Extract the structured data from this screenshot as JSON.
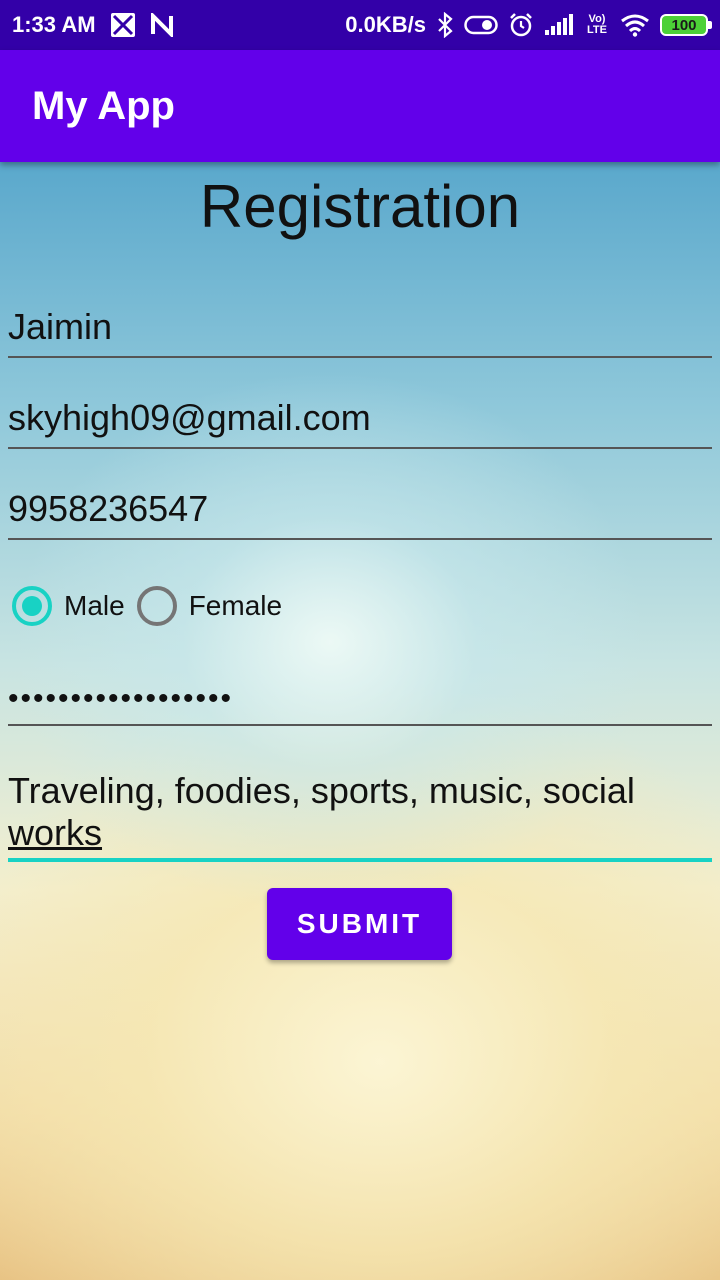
{
  "status_bar": {
    "time": "1:33 AM",
    "net_speed": "0.0KB/s",
    "battery": "100",
    "volte": "Vo) LTE"
  },
  "app_bar": {
    "title": "My App"
  },
  "form": {
    "title": "Registration",
    "name": "Jaimin",
    "email": "skyhigh09@gmail.com",
    "phone": "9958236547",
    "gender_options": [
      "Male",
      "Female"
    ],
    "gender_selected": "Male",
    "password_masked": "••••••••••••••••••",
    "interests_line1": "Traveling, foodies, sports, music, social",
    "interests_line2": "works",
    "submit_label": "SUBMIT"
  },
  "colors": {
    "status_bar": "#3300a8",
    "app_bar": "#6200ea",
    "accent": "#18d2c4",
    "button": "#6200ea"
  }
}
